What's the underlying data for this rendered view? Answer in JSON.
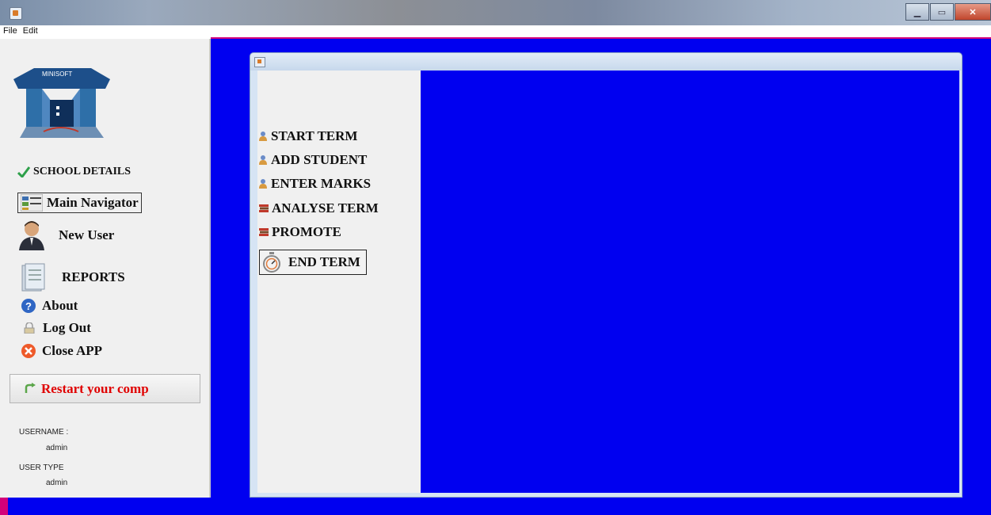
{
  "window": {
    "title": ""
  },
  "menubar": {
    "items": [
      "File",
      "Edit"
    ]
  },
  "sidebar": {
    "logo_text": "MINISOFT",
    "school_details": "SCHOOL DETAILS",
    "main_navigator": "Main Navigator",
    "new_user": "New User",
    "reports": "REPORTS",
    "about": "About",
    "log_out": "Log Out",
    "close_app": "Close APP",
    "restart": "Restart your comp",
    "username_label": "USERNAME :",
    "username_value": "admin",
    "user_type_label": "USER TYPE",
    "user_type_value": "admin"
  },
  "internal_frame": {
    "title": "",
    "menu": {
      "start_term": "START TERM",
      "add_student": "ADD STUDENT",
      "enter_marks": "ENTER MARKS",
      "analyse_term": "ANALYSE TERM",
      "promote": "PROMOTE",
      "end_term": "END TERM"
    }
  },
  "colors": {
    "desktop": "#0000f0",
    "accent": "#d3007a",
    "restart_text": "#e00000"
  },
  "icons": [
    "java-app-icon",
    "check-icon",
    "navigator-icon",
    "user-icon",
    "reports-icon",
    "help-icon",
    "log-out-icon",
    "close-icon",
    "restart-icon",
    "person-icon",
    "books-icon",
    "stopwatch-icon"
  ]
}
